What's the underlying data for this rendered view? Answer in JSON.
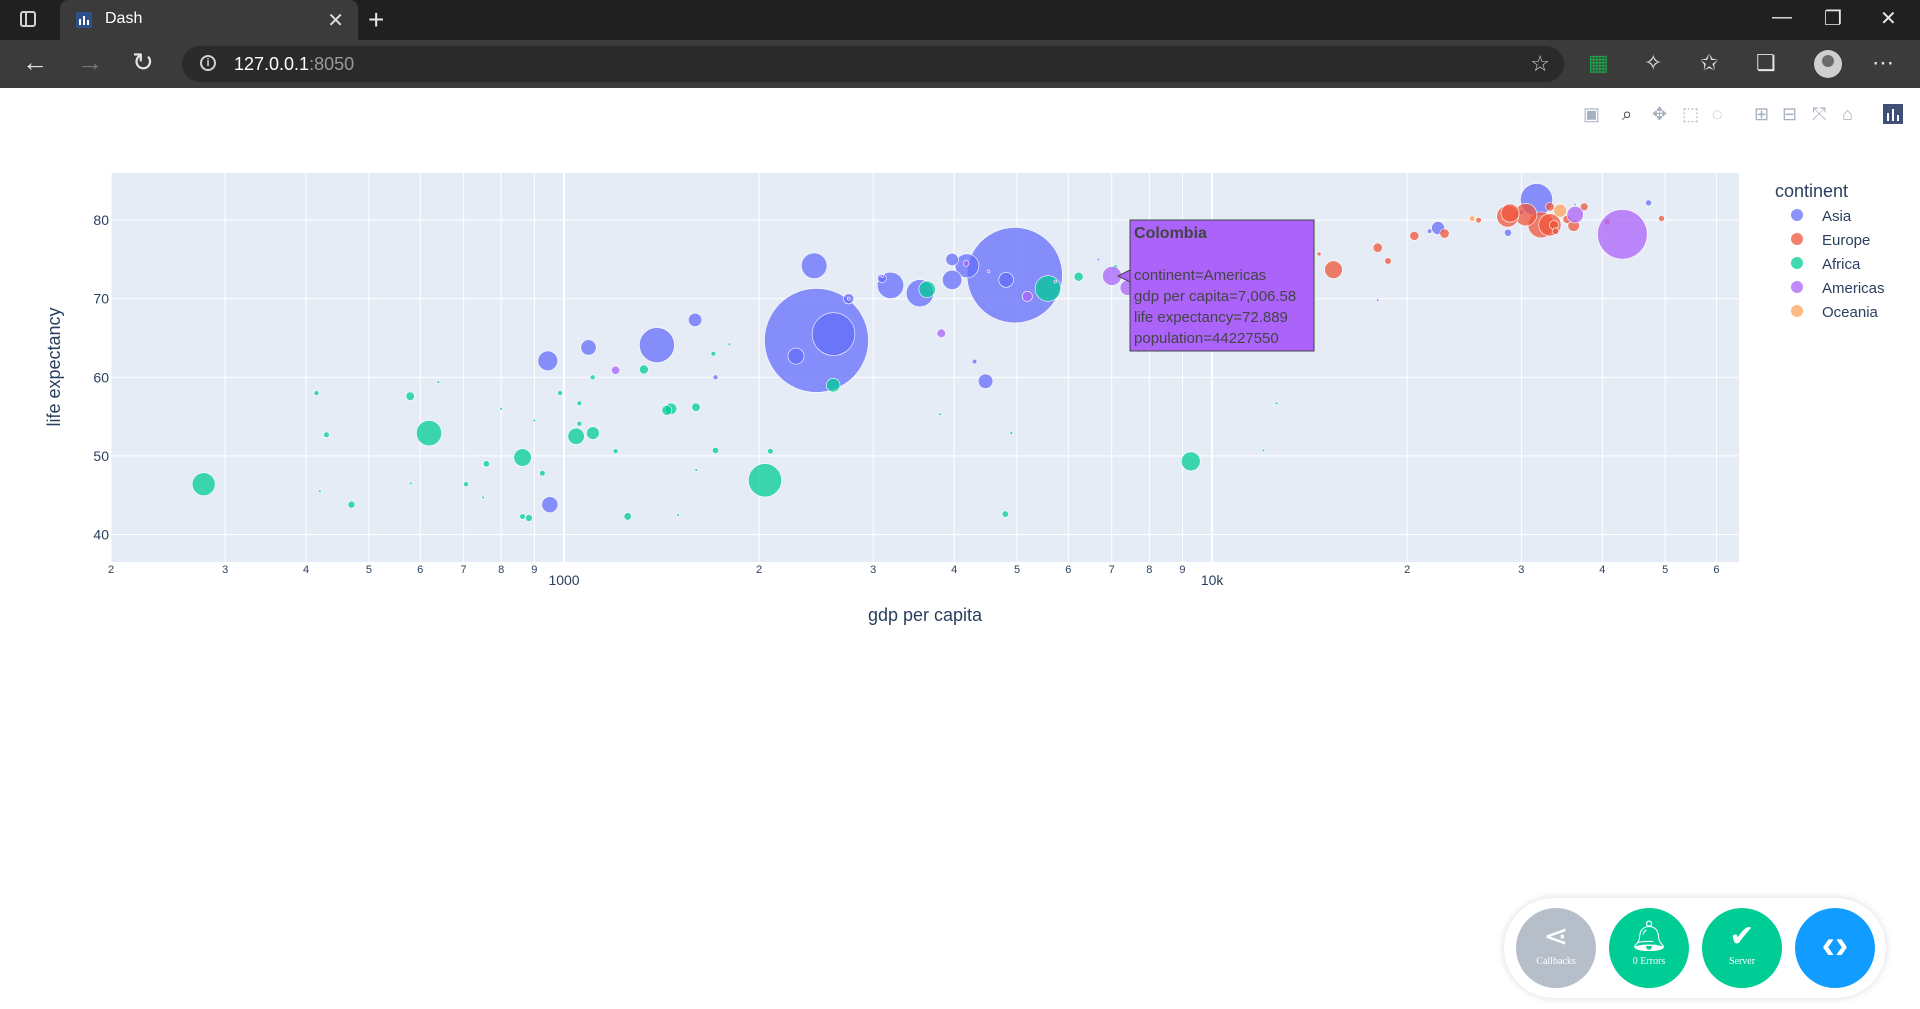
{
  "browser": {
    "tab_title": "Dash",
    "url_host": "127.0.0.1",
    "url_port": ":8050",
    "new_tab_symbol": "+",
    "icons": [
      "workspaces-icon",
      "back-icon",
      "forward-icon",
      "refresh-icon",
      "info-icon",
      "favorites-add-icon",
      "extension-icon",
      "puzzle-icon",
      "favorites-icon",
      "collections-icon",
      "profile-icon",
      "more-icon"
    ]
  },
  "modebar": {
    "icons": [
      "camera-icon",
      "zoom-icon",
      "pan-icon",
      "box-select-icon",
      "lasso-select-icon",
      "zoom-in-icon",
      "zoom-out-icon",
      "autoscale-icon",
      "reset-axes-icon",
      "plotly-logo-icon"
    ]
  },
  "chart_data": {
    "type": "scatter",
    "xlabel": "gdp per capita",
    "ylabel": "life expectancy",
    "x_scale": "log",
    "xlim": [
      200,
      65000
    ],
    "ylim": [
      36.5,
      86
    ],
    "x_ticks": [
      {
        "v": 200,
        "t": "2"
      },
      {
        "v": 300,
        "t": "3"
      },
      {
        "v": 400,
        "t": "4"
      },
      {
        "v": 500,
        "t": "5"
      },
      {
        "v": 600,
        "t": "6"
      },
      {
        "v": 700,
        "t": "7"
      },
      {
        "v": 800,
        "t": "8"
      },
      {
        "v": 900,
        "t": "9"
      },
      {
        "v": 1000,
        "t": "1000"
      },
      {
        "v": 2000,
        "t": "2"
      },
      {
        "v": 3000,
        "t": "3"
      },
      {
        "v": 4000,
        "t": "4"
      },
      {
        "v": 5000,
        "t": "5"
      },
      {
        "v": 6000,
        "t": "6"
      },
      {
        "v": 7000,
        "t": "7"
      },
      {
        "v": 8000,
        "t": "8"
      },
      {
        "v": 9000,
        "t": "9"
      },
      {
        "v": 10000,
        "t": "10k"
      },
      {
        "v": 20000,
        "t": "2"
      },
      {
        "v": 30000,
        "t": "3"
      },
      {
        "v": 40000,
        "t": "4"
      },
      {
        "v": 50000,
        "t": "5"
      },
      {
        "v": 60000,
        "t": "6"
      }
    ],
    "y_ticks": [
      40,
      50,
      60,
      70,
      80
    ],
    "grid": true,
    "legend": {
      "title": "continent",
      "placement": "top-right",
      "entries": [
        {
          "name": "Asia",
          "color": "#636efa"
        },
        {
          "name": "Europe",
          "color": "#ef553b"
        },
        {
          "name": "Africa",
          "color": "#00cc96"
        },
        {
          "name": "Americas",
          "color": "#ab63fa"
        },
        {
          "name": "Oceania",
          "color": "#ffa15a"
        }
      ]
    },
    "series": [
      {
        "name": "Asia",
        "color": "#636efa",
        "points": [
          [
            2452,
            64.7,
            1318683096
          ],
          [
            4959,
            73.0,
            1110396331
          ],
          [
            2605,
            65.5,
            223547000
          ],
          [
            1391,
            64.1,
            150448339
          ],
          [
            3541,
            70.7,
            91077287
          ],
          [
            3190,
            71.7,
            85262356
          ],
          [
            2432,
            74.2,
            80264543
          ],
          [
            944,
            62.1,
            47761980
          ],
          [
            1091,
            63.8,
            28901790
          ],
          [
            2280,
            62.7,
            31889923
          ],
          [
            31656,
            82.6,
            127467972
          ],
          [
            4185,
            74.2,
            69453570
          ],
          [
            12452,
            71.4,
            24821286
          ],
          [
            3970,
            72.4,
            46076000
          ],
          [
            1593,
            67.3,
            22276056
          ],
          [
            4471,
            59.5,
            26084662
          ],
          [
            4810,
            72.4,
            26666000
          ],
          [
            951,
            43.8,
            31889923
          ],
          [
            22316,
            79.0,
            21000000
          ],
          [
            47143,
            82.2,
            4553009
          ],
          [
            28604,
            78.4,
            6426679
          ],
          [
            21655,
            78.6,
            2505559
          ],
          [
            1713,
            60.0,
            3000000
          ],
          [
            3095,
            72.6,
            9319622
          ],
          [
            30000,
            81.0,
            3000000
          ],
          [
            2749,
            70.0,
            13000000
          ],
          [
            3970,
            75.0,
            19314747
          ],
          [
            4300,
            62.0,
            2700000
          ],
          [
            36319,
            82.0,
            708573
          ]
        ]
      },
      {
        "name": "Europe",
        "color": "#ef553b",
        "points": [
          [
            32170,
            79.4,
            82400996
          ],
          [
            30470,
            80.7,
            61083916
          ],
          [
            33203,
            79.4,
            60776238
          ],
          [
            28570,
            80.5,
            58147733
          ],
          [
            28821,
            80.9,
            40448191
          ],
          [
            15390,
            73.7,
            38518241
          ],
          [
            22833,
            78.3,
            10706290
          ],
          [
            36126,
            79.3,
            16570613
          ],
          [
            33693,
            79.4,
            10392226
          ],
          [
            40676,
            79.8,
            4627926
          ],
          [
            33207,
            81.7,
            9031088
          ],
          [
            35278,
            80.1,
            8199783
          ],
          [
            37506,
            81.7,
            7554661
          ],
          [
            33860,
            78.6,
            5468120
          ],
          [
            20510,
            78.0,
            10228744
          ],
          [
            18009,
            76.5,
            10642836
          ],
          [
            10808,
            72.5,
            22276056
          ],
          [
            9787,
            73.0,
            7322858
          ],
          [
            14619,
            75.7,
            2000000
          ],
          [
            25768,
            80.0,
            4000000
          ],
          [
            49357,
            80.2,
            4600000
          ],
          [
            36181,
            81.2,
            301931
          ],
          [
            18678,
            74.8,
            5447502
          ]
        ]
      },
      {
        "name": "Africa",
        "color": "#00cc96",
        "points": [
          [
            278,
            46.4,
            64606759
          ],
          [
            2042,
            46.9,
            135031164
          ],
          [
            5581,
            71.3,
            80264543
          ],
          [
            3633,
            71.2,
            33333216
          ],
          [
            9270,
            49.3,
            43997828
          ],
          [
            619,
            52.9,
            78000000
          ],
          [
            2602,
            59.0,
            22873338
          ],
          [
            863,
            49.8,
            38000000
          ],
          [
            1044,
            52.5,
            33000000
          ],
          [
            1108,
            52.9,
            20000000
          ],
          [
            1328,
            61.0,
            10000000
          ],
          [
            1463,
            56.0,
            16000000
          ],
          [
            1441,
            55.8,
            12000000
          ],
          [
            1598,
            56.2,
            9000000
          ],
          [
            883,
            42.1,
            6000000
          ],
          [
            6223,
            72.8,
            10000000
          ],
          [
            1713,
            50.7,
            5000000
          ],
          [
            1201,
            50.6,
            3000000
          ],
          [
            759,
            49.0,
            5000000
          ],
          [
            430,
            52.7,
            4000000
          ],
          [
            470,
            43.8,
            6000000
          ],
          [
            706,
            46.4,
            3000000
          ],
          [
            579,
            57.6,
            9000000
          ],
          [
            1254,
            42.3,
            7000000
          ],
          [
            926,
            47.8,
            4000000
          ],
          [
            986,
            58.0,
            3000000
          ],
          [
            4797,
            42.6,
            5000000
          ],
          [
            2082,
            50.6,
            4000000
          ],
          [
            1056,
            56.7,
            3000000
          ],
          [
            1107,
            60.0,
            3000000
          ],
          [
            1056,
            54.1,
            3000000
          ],
          [
            415,
            58.0,
            3000000
          ],
          [
            863,
            42.3,
            4000000
          ],
          [
            7092,
            74.0,
            3000000
          ],
          [
            12570,
            56.7,
            1000000
          ],
          [
            12000,
            50.7,
            1000000
          ],
          [
            1700,
            63.0,
            3000000
          ],
          [
            1600,
            48.2,
            1000000
          ],
          [
            800,
            56.0,
            1000000
          ],
          [
            1500,
            42.5,
            1000000
          ],
          [
            900,
            54.5,
            1000000
          ],
          [
            4900,
            52.9,
            1000000
          ],
          [
            640,
            59.4,
            1000000
          ],
          [
            3800,
            55.3,
            1000000
          ],
          [
            1800,
            64.2,
            1000000
          ],
          [
            750,
            44.7,
            1000000
          ],
          [
            580,
            46.5,
            1000000
          ],
          [
            420,
            45.5,
            1000000
          ]
        ]
      },
      {
        "name": "Americas",
        "color": "#ab63fa",
        "points": [
          [
            42952,
            78.2,
            301139947
          ],
          [
            9066,
            72.4,
            190010647
          ],
          [
            11977,
            76.2,
            108700891
          ],
          [
            7007,
            72.9,
            44227550
          ],
          [
            12779,
            75.3,
            40301927
          ],
          [
            36319,
            80.7,
            33390141
          ],
          [
            7409,
            71.4,
            28674757
          ],
          [
            11416,
            73.7,
            26084662
          ],
          [
            13172,
            78.6,
            16284741
          ],
          [
            7452,
            73.0,
            13755680
          ],
          [
            5186,
            70.3,
            12572928
          ],
          [
            3820,
            65.6,
            9119152
          ],
          [
            4173,
            74.5,
            4133884
          ],
          [
            9645,
            75.5,
            3242173
          ],
          [
            10611,
            78.8,
            4000000
          ],
          [
            8948,
            78.3,
            11416987
          ],
          [
            7670,
            76.4,
            10000000
          ],
          [
            3098,
            72.9,
            1000000
          ],
          [
            6677,
            75.0,
            1000000
          ],
          [
            5728,
            72.2,
            1000000
          ],
          [
            4519,
            73.5,
            1000000
          ],
          [
            2749,
            70.0,
            1000000
          ],
          [
            1201,
            60.9,
            8502814
          ],
          [
            18009,
            69.8,
            1000000
          ],
          [
            7670,
            69.8,
            1000000
          ]
        ]
      },
      {
        "name": "Oceania",
        "color": "#ffa15a",
        "points": [
          [
            34435,
            81.2,
            20434176
          ],
          [
            25185,
            80.2,
            4115771
          ]
        ]
      }
    ],
    "hover": {
      "title": "Colombia",
      "lines": [
        "continent=Americas",
        "gdp per capita=7,006.58",
        "life expectancy=72.889",
        "population=44227550"
      ]
    }
  },
  "devtools": {
    "callbacks_label": "Callbacks",
    "errors_label": "0 Errors",
    "server_label": "Server"
  }
}
